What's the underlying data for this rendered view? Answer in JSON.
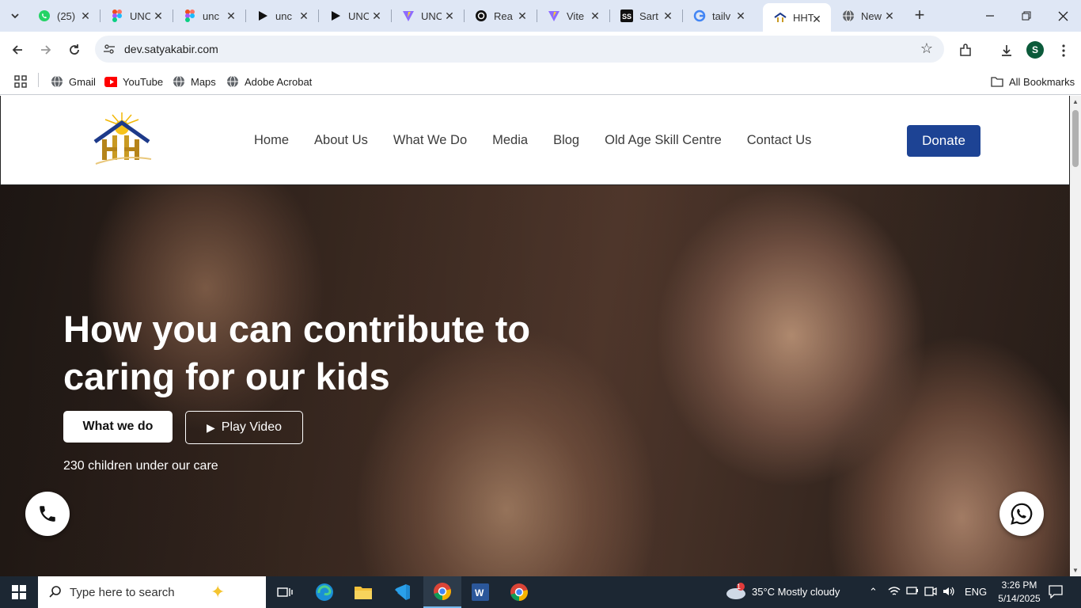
{
  "browser": {
    "tabs": [
      {
        "title": "(25)",
        "icon": "whatsapp-icon"
      },
      {
        "title": "UNC",
        "icon": "figma-icon"
      },
      {
        "title": "unc",
        "icon": "figma-icon"
      },
      {
        "title": "unc",
        "icon": "play-icon"
      },
      {
        "title": "UNC",
        "icon": "play-icon"
      },
      {
        "title": "UNC",
        "icon": "vite-icon"
      },
      {
        "title": "Rea",
        "icon": "openai-icon"
      },
      {
        "title": "Vite",
        "icon": "vite-icon"
      },
      {
        "title": "Sart",
        "icon": "ss-icon"
      },
      {
        "title": "tailv",
        "icon": "google-icon"
      },
      {
        "title": "HHT",
        "icon": "site-icon",
        "active": true
      },
      {
        "title": "New",
        "icon": "globe-icon"
      }
    ],
    "url": "dev.satyakabir.com",
    "profile_initial": "S",
    "bookmarks": [
      {
        "label": "Gmail",
        "icon": "globe-icon"
      },
      {
        "label": "YouTube",
        "icon": "youtube-icon"
      },
      {
        "label": "Maps",
        "icon": "globe-icon"
      },
      {
        "label": "Adobe Acrobat",
        "icon": "globe-icon"
      }
    ],
    "all_bookmarks": "All Bookmarks"
  },
  "site": {
    "nav": [
      "Home",
      "About Us",
      "What We Do",
      "Media",
      "Blog",
      "Old Age Skill Centre",
      "Contact Us"
    ],
    "donate_label": "Donate",
    "accent_color": "#1d4394",
    "hero": {
      "title": "How you can contribute to caring for our kids",
      "primary_button": "What we do",
      "secondary_button": "Play Video",
      "children_text": "230 children under our care"
    }
  },
  "taskbar": {
    "search_placeholder": "Type here to search",
    "weather": "35°C  Mostly cloudy",
    "weather_badge": "1",
    "language": "ENG",
    "time": "3:26 PM",
    "date": "5/14/2025"
  }
}
